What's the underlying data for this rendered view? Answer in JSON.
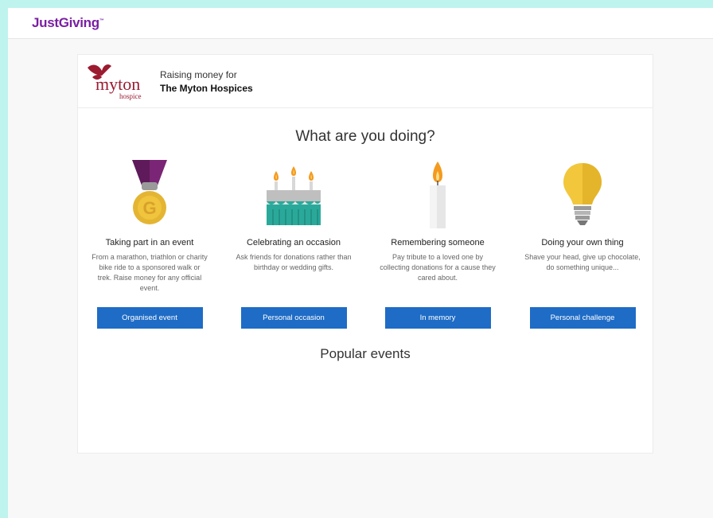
{
  "header": {
    "logo_text": "JustGiving",
    "logo_tm": "™"
  },
  "charity": {
    "raising_label": "Raising money for",
    "name": "The Myton Hospices",
    "logo_word": "myton",
    "logo_sub": "hospice"
  },
  "main": {
    "question": "What are you doing?",
    "popular_heading": "Popular events",
    "options": [
      {
        "icon": "medal-icon",
        "title": "Taking part in an event",
        "description": "From a marathon, triathlon or charity bike ride to a sponsored walk or trek. Raise money for any official event.",
        "button": "Organised event"
      },
      {
        "icon": "birthday-cake-icon",
        "title": "Celebrating an occasion",
        "description": "Ask friends for donations rather than birthday or wedding gifts.",
        "button": "Personal occasion"
      },
      {
        "icon": "candle-icon",
        "title": "Remembering someone",
        "description": "Pay tribute to a loved one by collecting donations for a cause they cared about.",
        "button": "In memory"
      },
      {
        "icon": "lightbulb-icon",
        "title": "Doing your own thing",
        "description": "Shave your head, give up chocolate, do something unique...",
        "button": "Personal challenge"
      }
    ]
  },
  "colors": {
    "brand": "#7a1fa2",
    "button": "#1f6cc6",
    "myton": "#9b1b30"
  }
}
